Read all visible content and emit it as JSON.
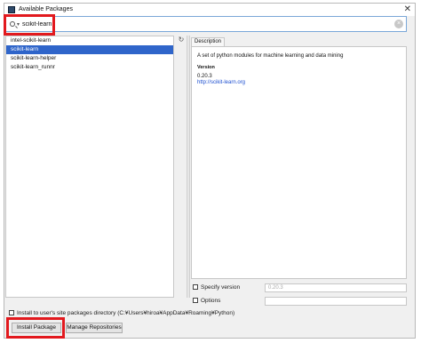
{
  "window": {
    "title": "Available Packages",
    "close_glyph": "✕",
    "icon": "pycharm-icon"
  },
  "search": {
    "value": "scikit-learn",
    "clear_glyph": "×",
    "caret": "▾"
  },
  "package_list": {
    "items": [
      {
        "label": "intel-scikit-learn",
        "selected": false
      },
      {
        "label": "scikit-learn",
        "selected": true
      },
      {
        "label": "scikit-learn-helper",
        "selected": false
      },
      {
        "label": "scikit-learn_runnr",
        "selected": false
      }
    ],
    "refresh_glyph": "↻"
  },
  "description": {
    "tab_label": "Description",
    "summary": "A set of python modules for machine learning and data mining",
    "version_label": "Version",
    "version_value": "0.20.3",
    "link": "http://scikit-learn.org"
  },
  "options": {
    "specify_version_label": "Specify version",
    "specify_version_value": "0.20.3",
    "options_label": "Options",
    "install_user_site_label": "Install to user's site packages directory (C:¥Users¥hiroa¥AppData¥Roaming¥Python)"
  },
  "buttons": {
    "install_label": "Install Package",
    "manage_label": "Manage Repositories"
  },
  "colors": {
    "highlight": "#e2191e",
    "selection": "#2f65ca",
    "link": "#1d4fd0"
  }
}
